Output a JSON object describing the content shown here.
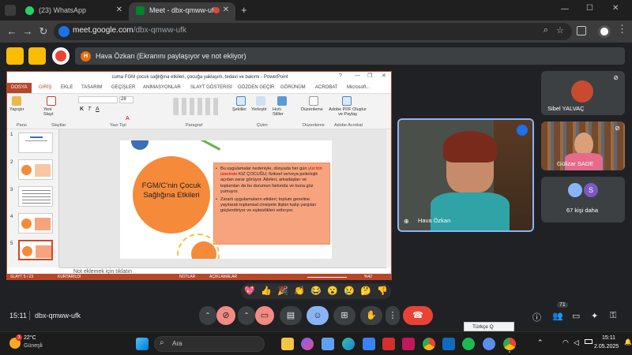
{
  "browser": {
    "tabs": [
      {
        "label": "(23) WhatsApp",
        "active": false
      },
      {
        "label": "Meet - dbx-qmww-ufk",
        "active": true
      }
    ],
    "new_tab": "+",
    "url_host": "meet.google.com",
    "url_path": "/dbx-qmww-ufk"
  },
  "meet": {
    "banner": "Hava Özkan (Ekranını paylaşıyor ve not ekliyor)",
    "banner_initial": "H",
    "meeting_code": "dbx-qmww-ufk",
    "time": "15:11",
    "participant_count_badge": "71",
    "participants": [
      {
        "name": "Sibel YALVAÇ"
      },
      {
        "name": "Gülizar SADE"
      },
      {
        "name": "Hava Özkan"
      }
    ],
    "more_people": "67 kişi daha",
    "more_initial": "S",
    "language_chip": "Türkçe Q"
  },
  "powerpoint": {
    "title": "cuma FGM çocuk sağlığına etkileri, çocuğa yaklaşım, tedavi ve bakımı - PowerPoint",
    "ribbon_tabs": [
      "DOSYA",
      "GİRİŞ",
      "EKLE",
      "TASARIM",
      "GEÇİŞLER",
      "ANİMASYONLAR",
      "SLAYT GÖSTERİSİ",
      "GÖZDEN GEÇİR",
      "GÖRÜNÜM",
      "ACROBAT",
      "Microsoft..."
    ],
    "groups": [
      "Pano",
      "Slaytlar",
      "Yazı Tipi",
      "Paragraf",
      "Çizim",
      "Düzenleme",
      "Adobe Acrobat"
    ],
    "buttons": {
      "paste": "Yapıştır",
      "new_slide": "Yeni Slayt",
      "shapes": "Şekiller",
      "arrange": "Yerleştir",
      "quick_styles": "Hızlı Stiller",
      "editing": "Düzenleme",
      "adobe_pdf": "Adobe PDF Oluştur ve Paylaş",
      "font_size": "28"
    },
    "slide_numbers": [
      "1",
      "2",
      "3",
      "4",
      "5"
    ],
    "slide": {
      "title": "FGM/C'nin Çocuk Sağlığına Etkileri",
      "bullet1_pre": "Bu uygulamalar nedeniyle, dünyada her gün ",
      "bullet1_highlight": "yüz bin üzerinde",
      "bullet1_post": " KIZ ÇOCUĞU; fiziksel ve/veya psikolojik açıdan zarar görüyor. Aileleri, arkadaşları ve toplumları da bu durumun farkında ve buna göz yumuyor.",
      "bullet2": "Zararlı uygulamaların etkileri; toplum geneline yayılarak toplumsal cinsiyete ilişkin kalıp yargıları güçlendiriyor ve eşitsizlikleri arttırıyor."
    },
    "notes_placeholder": "Not eklemek için tıklatın",
    "status": {
      "slide": "SLAYT 5 / 23",
      "language": "KURTARILDI",
      "notes": "NOTLAR",
      "comments": "AÇIKLAMALAR",
      "zoom": "%42"
    }
  },
  "reactions": [
    "💖",
    "👍",
    "🎉",
    "👏",
    "😂",
    "😮",
    "😢",
    "🤔",
    "👎"
  ],
  "taskbar": {
    "weather_temp": "22°C",
    "weather_desc": "Güneşli",
    "weather_badge": "3",
    "search": "Ara",
    "clock_time": "15:11",
    "clock_date": "2.05.2025"
  },
  "colors": {
    "accent": "#1a73e8",
    "end_call": "#ea4335",
    "ppt_brand": "#b7472a",
    "slide_orange": "#f58b3a",
    "slide_box": "#f7a47e",
    "slide_green": "#6ab04c"
  }
}
